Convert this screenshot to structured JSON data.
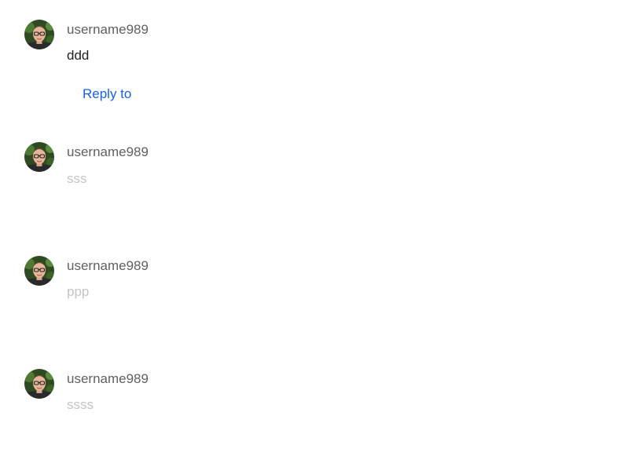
{
  "comments": [
    {
      "username": "username989",
      "text": "ddd",
      "reply_label": "Reply to",
      "avatar_icon": "user-avatar-icon"
    },
    {
      "username": "username989",
      "text": "sss",
      "avatar_icon": "user-avatar-icon"
    },
    {
      "username": "username989",
      "text": "ppp",
      "avatar_icon": "user-avatar-icon"
    },
    {
      "username": "username989",
      "text": "ssss",
      "avatar_icon": "user-avatar-icon"
    }
  ],
  "colors": {
    "username": "#5f5f5f",
    "active_text": "#222222",
    "muted_text": "#c4c4c4",
    "link": "#1a5fe0"
  }
}
